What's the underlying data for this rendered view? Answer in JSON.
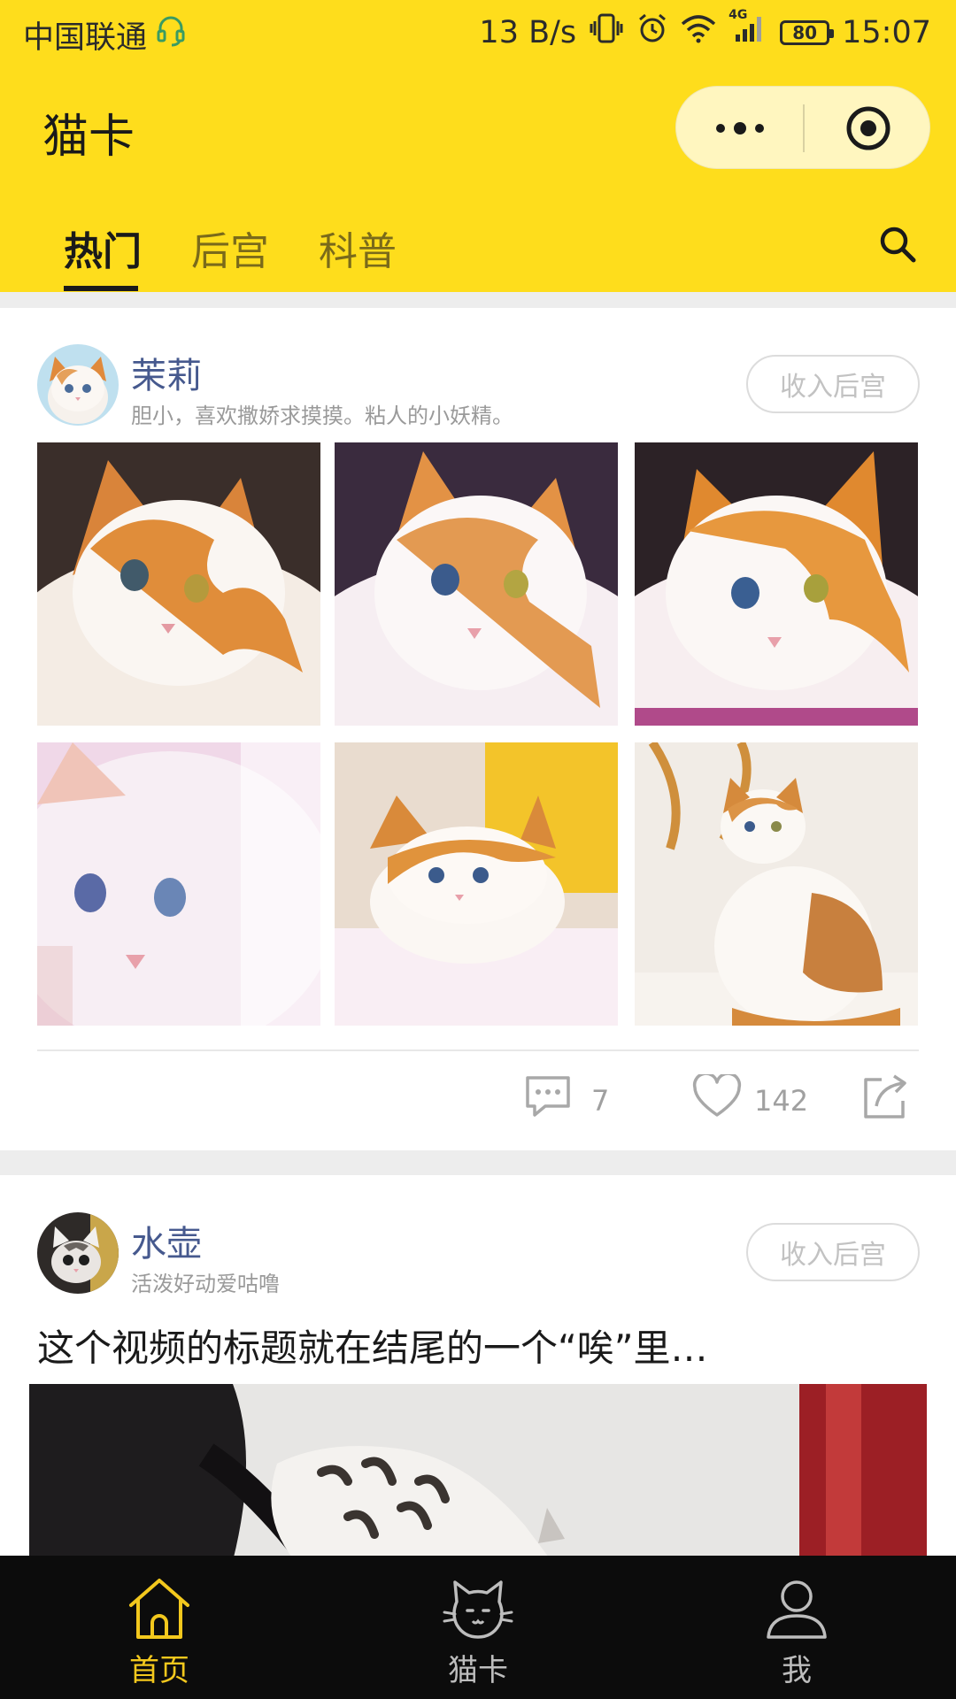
{
  "status_bar": {
    "carrier": "中国联通",
    "net_speed": "13 B/s",
    "network_type": "4G",
    "battery": "80",
    "time": "15:07"
  },
  "header": {
    "title": "猫卡",
    "bg_color": "#fedd1c"
  },
  "tabs": [
    {
      "label": "热门",
      "active": true
    },
    {
      "label": "后宫",
      "active": false
    },
    {
      "label": "科普",
      "active": false
    }
  ],
  "posts": [
    {
      "name": "茉莉",
      "description": "胆小，喜欢撒娇求摸摸。粘人的小妖精。",
      "adopt_label": "收入后宫",
      "comments": "7",
      "likes": "142",
      "photos": [
        "cat-photo-1",
        "cat-photo-2",
        "cat-photo-3",
        "cat-photo-4",
        "cat-photo-5",
        "cat-photo-6"
      ]
    },
    {
      "name": "水壶",
      "description": "活泼好动爱咕噜",
      "adopt_label": "收入后宫",
      "video_title": "这个视频的标题就在结尾的一个“唉”里…"
    }
  ],
  "bottom_nav": [
    {
      "label": "首页",
      "icon": "home-icon",
      "active": true
    },
    {
      "label": "猫卡",
      "icon": "cat-icon",
      "active": false
    },
    {
      "label": "我",
      "icon": "profile-icon",
      "active": false
    }
  ],
  "colors": {
    "accent_yellow": "#fedd1c",
    "active_nav": "#f3c81d",
    "name_blue": "#46598e"
  }
}
